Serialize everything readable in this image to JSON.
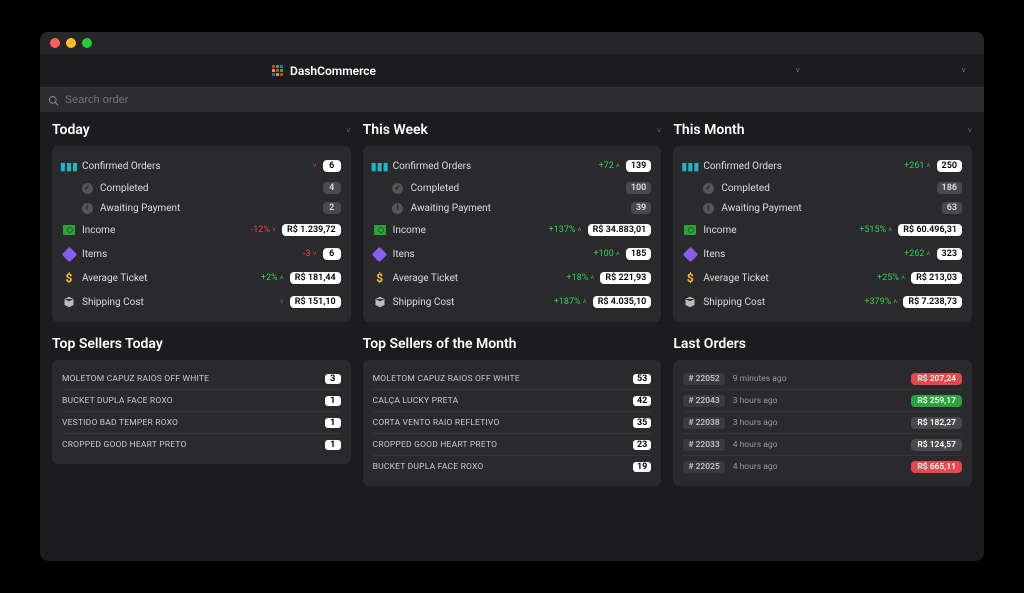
{
  "brand": "DashCommerce",
  "search": {
    "placeholder": "Search order"
  },
  "panels": {
    "today": {
      "title": "Today",
      "confirmed": {
        "label": "Confirmed Orders",
        "delta": "",
        "dir": "down",
        "value": "6"
      },
      "completed": {
        "label": "Completed",
        "value": "4"
      },
      "awaiting": {
        "label": "Awaiting Payment",
        "value": "2"
      },
      "income": {
        "label": "Income",
        "delta": "-12%",
        "dir": "down",
        "value": "R$ 1.239,72"
      },
      "items": {
        "label": "Items",
        "delta": "-3",
        "dir": "down",
        "value": "6"
      },
      "ticket": {
        "label": "Average Ticket",
        "delta": "+2%",
        "dir": "up",
        "value": "R$ 181,44"
      },
      "ship": {
        "label": "Shipping Cost",
        "delta": "",
        "dir": "down",
        "value": "R$ 151,10"
      }
    },
    "week": {
      "title": "This Week",
      "confirmed": {
        "label": "Confirmed Orders",
        "delta": "+72",
        "dir": "up",
        "value": "139"
      },
      "completed": {
        "label": "Completed",
        "value": "100"
      },
      "awaiting": {
        "label": "Awaiting Payment",
        "value": "39"
      },
      "income": {
        "label": "Income",
        "delta": "+137%",
        "dir": "up",
        "value": "R$ 34.883,01"
      },
      "items": {
        "label": "Itens",
        "delta": "+100",
        "dir": "up",
        "value": "185"
      },
      "ticket": {
        "label": "Average Ticket",
        "delta": "+18%",
        "dir": "up",
        "value": "R$ 221,93"
      },
      "ship": {
        "label": "Shipping Cost",
        "delta": "+187%",
        "dir": "up",
        "value": "R$ 4.035,10"
      }
    },
    "month": {
      "title": "This Month",
      "confirmed": {
        "label": "Confirmed Orders",
        "delta": "+261",
        "dir": "up",
        "value": "250"
      },
      "completed": {
        "label": "Completed",
        "value": "186"
      },
      "awaiting": {
        "label": "Awaiting Payment",
        "value": "63"
      },
      "income": {
        "label": "Income",
        "delta": "+515%",
        "dir": "up",
        "value": "R$ 60.496,31"
      },
      "items": {
        "label": "Itens",
        "delta": "+262",
        "dir": "up",
        "value": "323"
      },
      "ticket": {
        "label": "Average Ticket",
        "delta": "+25%",
        "dir": "up",
        "value": "R$ 213,03"
      },
      "ship": {
        "label": "Shipping Cost",
        "delta": "+379%",
        "dir": "up",
        "value": "R$ 7.238,73"
      }
    }
  },
  "sellers_today": {
    "title": "Top Sellers Today",
    "rows": [
      {
        "name": "MOLETOM CAPUZ RAIOS OFF WHITE",
        "count": "3"
      },
      {
        "name": "BUCKET DUPLA FACE ROXO",
        "count": "1"
      },
      {
        "name": "VESTIDO BAD TEMPER ROXO",
        "count": "1"
      },
      {
        "name": "CROPPED GOOD HEART PRETO",
        "count": "1"
      }
    ]
  },
  "sellers_month": {
    "title": "Top Sellers of the Month",
    "rows": [
      {
        "name": "MOLETOM CAPUZ RAIOS OFF WHITE",
        "count": "53"
      },
      {
        "name": "CALÇA LUCKY PRETA",
        "count": "42"
      },
      {
        "name": "CORTA VENTO RAIO REFLETIVO",
        "count": "35"
      },
      {
        "name": "CROPPED GOOD HEART PRETO",
        "count": "23"
      },
      {
        "name": "BUCKET DUPLA FACE ROXO",
        "count": "19"
      }
    ]
  },
  "last_orders": {
    "title": "Last Orders",
    "rows": [
      {
        "id": "# 22052",
        "time": "9 minutes ago",
        "price": "R$ 207,24",
        "tone": "red"
      },
      {
        "id": "# 22043",
        "time": "3 hours ago",
        "price": "R$ 259,17",
        "tone": "green"
      },
      {
        "id": "# 22038",
        "time": "3 hours ago",
        "price": "R$ 182,27",
        "tone": "grey"
      },
      {
        "id": "# 22033",
        "time": "4 hours ago",
        "price": "R$ 124,57",
        "tone": "grey"
      },
      {
        "id": "# 22025",
        "time": "4 hours ago",
        "price": "R$ 665,11",
        "tone": "red"
      }
    ]
  }
}
